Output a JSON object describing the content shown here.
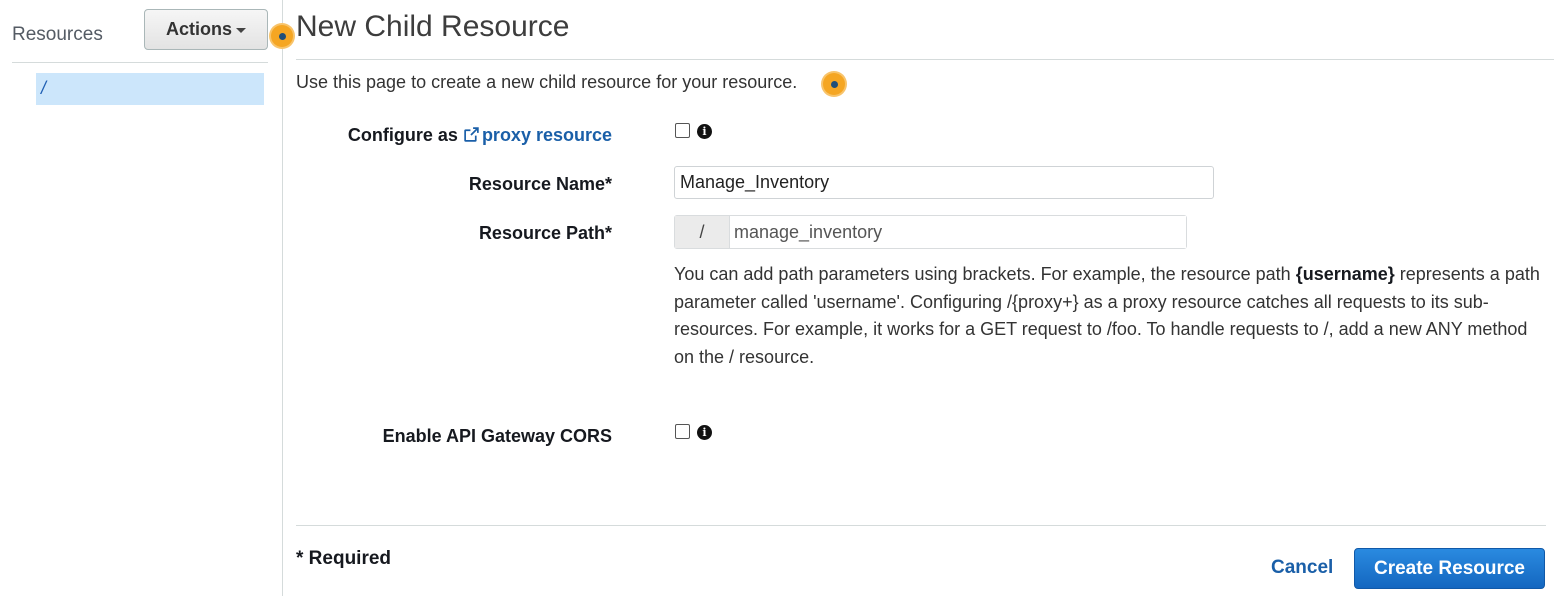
{
  "sidebar": {
    "title": "Resources",
    "actions_label": "Actions",
    "tree_items": [
      "/"
    ]
  },
  "main": {
    "title": "New Child Resource",
    "intro": "Use this page to create a new child resource for your resource.",
    "proxy": {
      "label_prefix": "Configure as ",
      "link_text": "proxy resource",
      "checked": false
    },
    "resource_name": {
      "label": "Resource Name*",
      "value": "Manage_Inventory"
    },
    "resource_path": {
      "label": "Resource Path*",
      "prefix": "/",
      "value": "manage_inventory"
    },
    "help": {
      "part1": "You can add path parameters using brackets. For example, the resource path ",
      "bold": "{username}",
      "part2": " represents a path parameter called 'username'. Configuring /{proxy+} as a proxy resource catches all requests to its sub-resources. For example, it works for a GET request to /foo. To handle requests to /, add a new ANY method on the / resource."
    },
    "cors": {
      "label": "Enable API Gateway CORS",
      "checked": false
    },
    "required_note": "* Required",
    "cancel_label": "Cancel",
    "create_label": "Create Resource"
  },
  "colors": {
    "accent": "#1a5fa8",
    "selected_bg": "#cce6fb",
    "tour_dot": "#f5a623",
    "primary_button": "#1467c0"
  },
  "icons": [
    "caret-down-icon",
    "external-link-icon",
    "info-icon",
    "tour-hotspot-icon"
  ]
}
